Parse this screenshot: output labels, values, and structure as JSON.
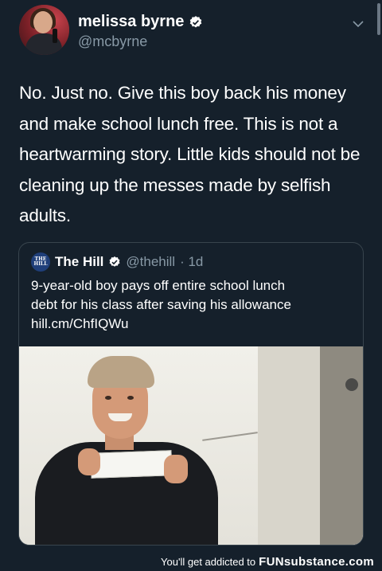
{
  "tweet": {
    "display_name": "melissa byrne",
    "handle": "@mcbyrne",
    "text": "No. Just no. Give this boy back his money and make school lunch free. This is not a heartwarming story. Little kids should not be cleaning up the messes made by selfish adults."
  },
  "quoted_tweet": {
    "logo_text": "THE HILL",
    "display_name": "The Hill",
    "handle": "@thehill",
    "time": "· 1d",
    "text_line1": "9-year-old boy pays off entire school lunch",
    "text_line2": "debt for his class after saving his allowance",
    "link": "hill.cm/ChfIQWu"
  },
  "footer": {
    "prefix": "You'll get addicted to",
    "brand": "FUNsubstance.com"
  },
  "colors": {
    "background": "#15202b",
    "secondary_text": "#8899a6",
    "border": "#38444d",
    "verified": "#ffffff"
  },
  "icons": [
    "verified-badge-icon",
    "chevron-down-icon",
    "verified-badge-icon"
  ]
}
